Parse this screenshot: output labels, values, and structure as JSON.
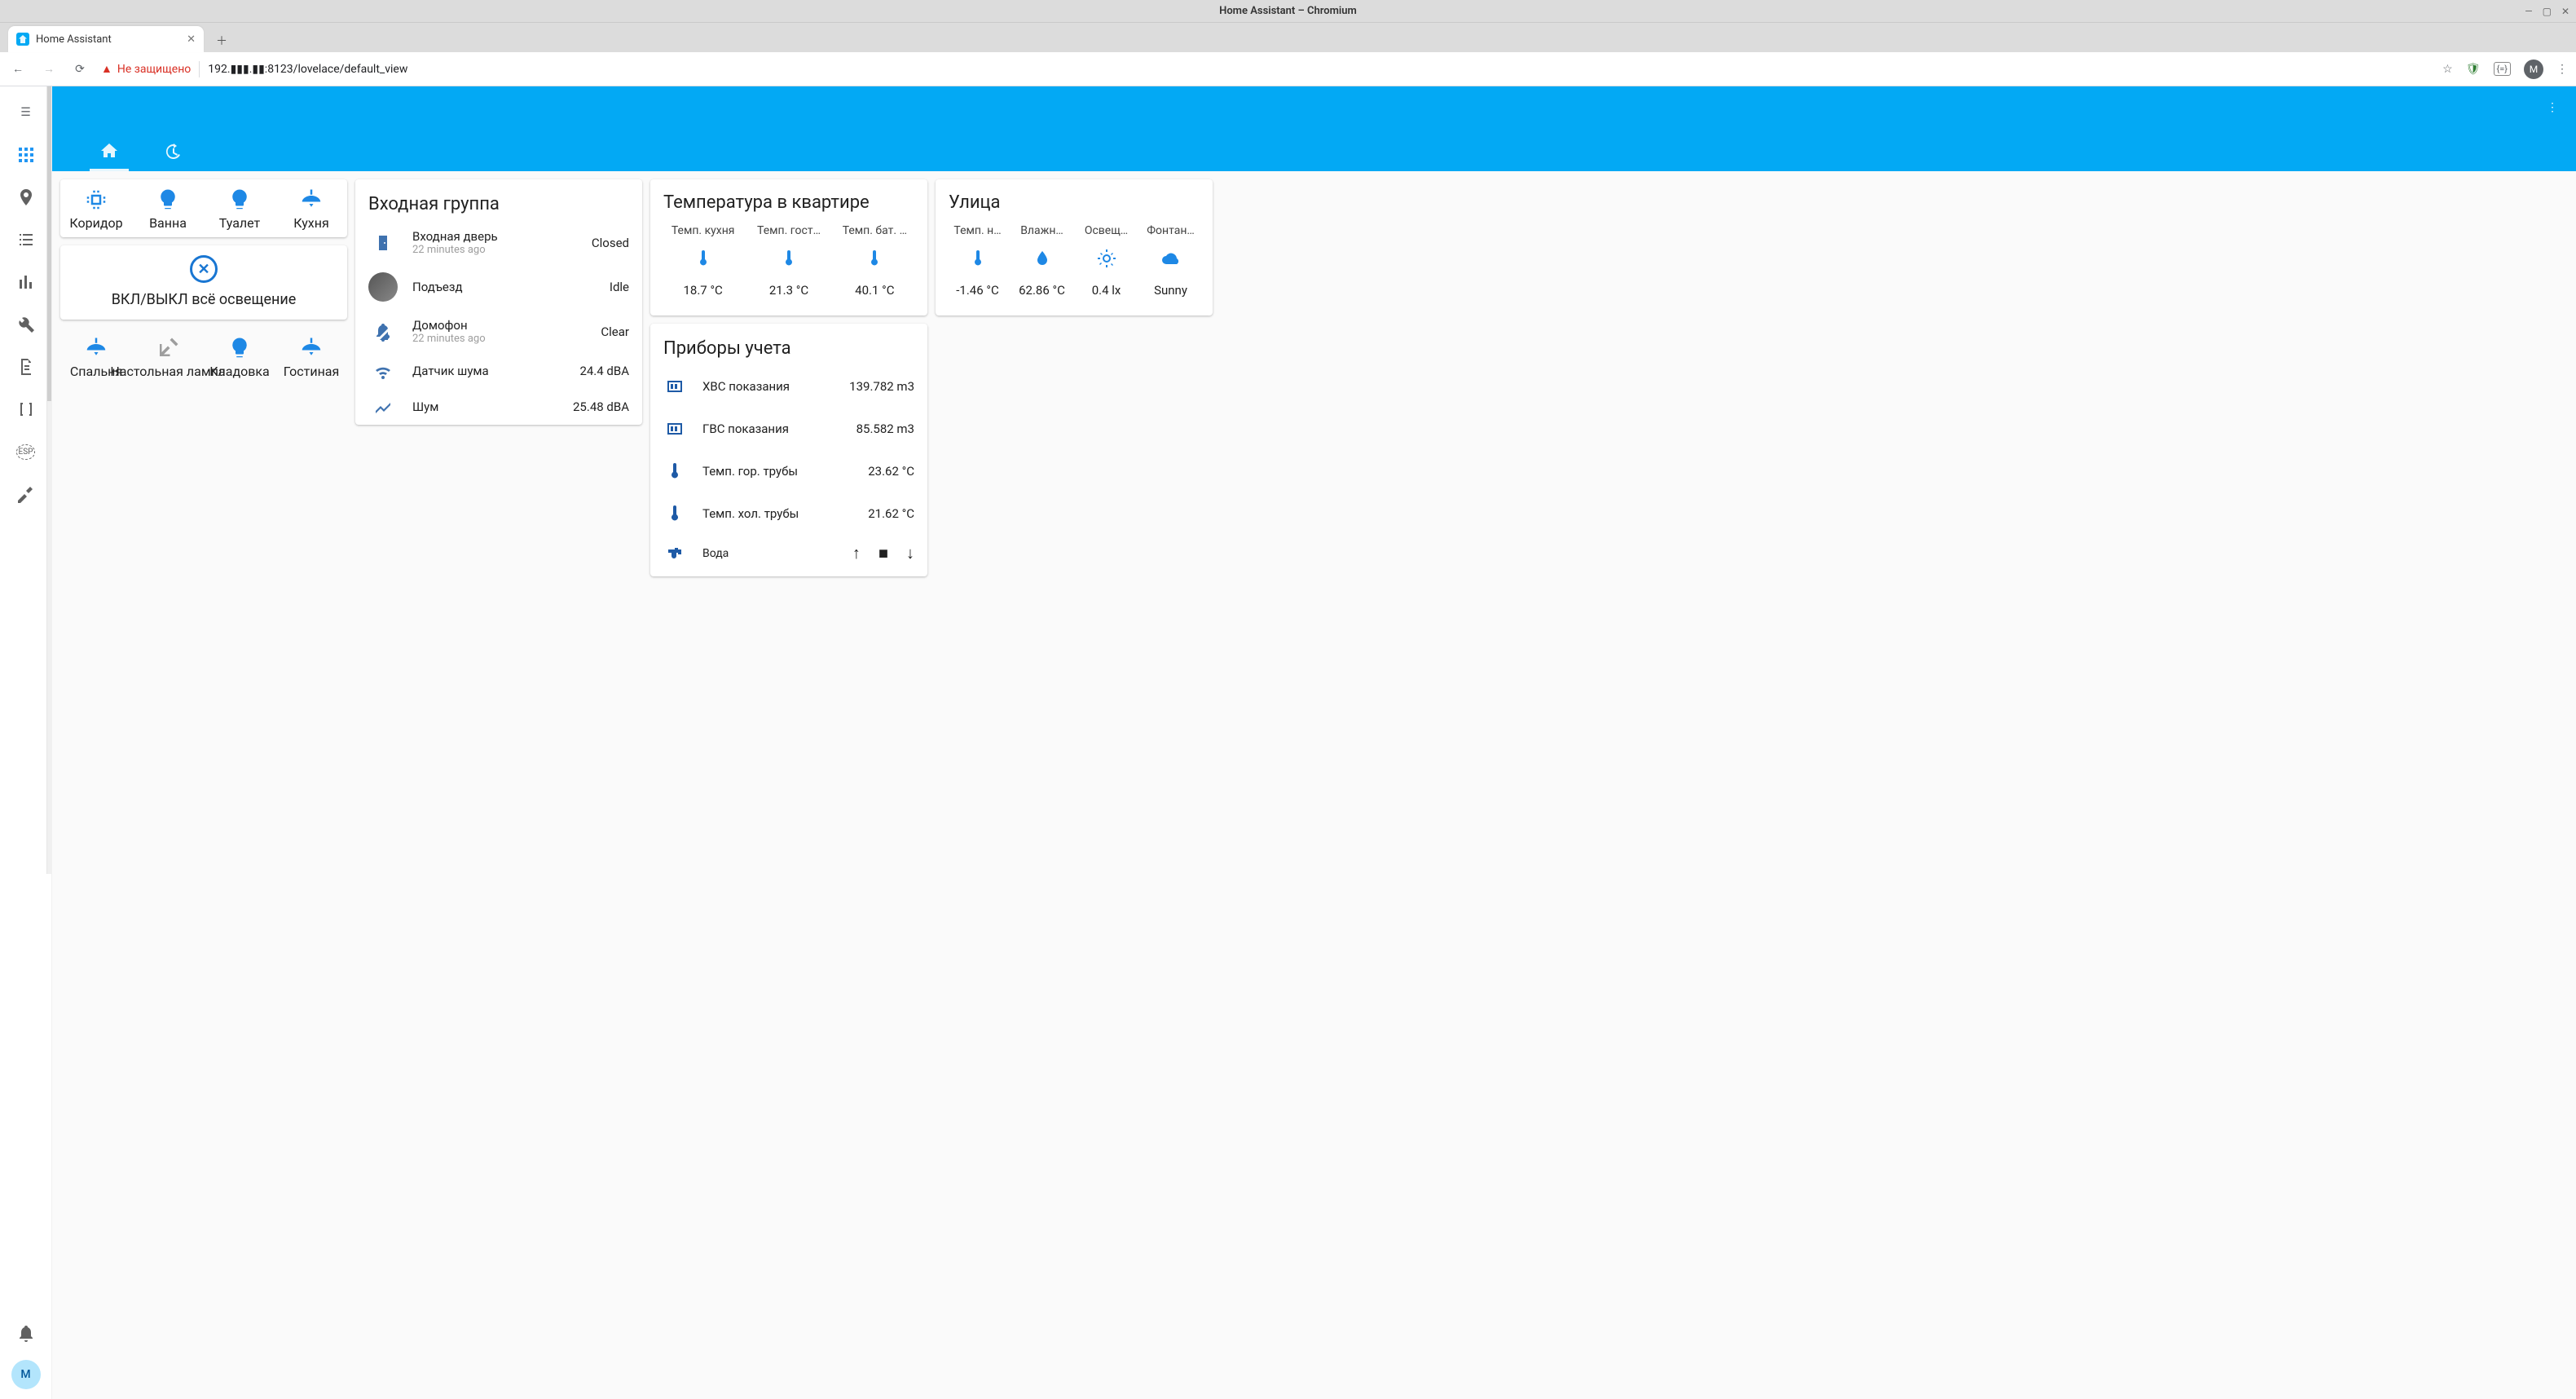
{
  "os": {
    "title": "Home Assistant – Chromium"
  },
  "browser": {
    "tab_title": "Home Assistant",
    "security_label": "Не защищено",
    "url": "192.▮▮▮.▮▮:8123/lovelace/default_view",
    "avatar_letter": "M"
  },
  "sidebar": {
    "avatar_letter": "M"
  },
  "lights": {
    "row1": [
      {
        "label": "Коридор",
        "icon": "memory",
        "state": "on"
      },
      {
        "label": "Ванна",
        "icon": "bulb",
        "state": "on"
      },
      {
        "label": "Туалет",
        "icon": "bulb",
        "state": "on"
      },
      {
        "label": "Кухня",
        "icon": "ceiling",
        "state": "on"
      }
    ],
    "all_toggle_label": "ВКЛ/ВЫКЛ всё освещение",
    "row2": [
      {
        "label": "Спальня",
        "icon": "ceiling",
        "state": "on"
      },
      {
        "label": "Настольная лампа",
        "icon": "desk",
        "state": "off"
      },
      {
        "label": "Кладовка",
        "icon": "bulb",
        "state": "on"
      },
      {
        "label": "Гостиная",
        "icon": "ceiling",
        "state": "on"
      }
    ]
  },
  "entrance": {
    "title": "Входная группа",
    "items": [
      {
        "icon": "door",
        "name": "Входная дверь",
        "sub": "22 minutes ago",
        "value": "Closed"
      },
      {
        "icon": "camera",
        "name": "Подъезд",
        "sub": "",
        "value": "Idle"
      },
      {
        "icon": "bell-off",
        "name": "Домофон",
        "sub": "22 minutes ago",
        "value": "Clear"
      },
      {
        "icon": "wifi",
        "name": "Датчик шума",
        "sub": "",
        "value": "24.4 dBA"
      },
      {
        "icon": "chart",
        "name": "Шум",
        "sub": "",
        "value": "25.48 dBA"
      }
    ]
  },
  "apt_temp": {
    "title": "Температура в квартире",
    "items": [
      {
        "label": "Темп. кухня",
        "icon": "thermo",
        "value": "18.7 °C"
      },
      {
        "label": "Темп. гост…",
        "icon": "thermo",
        "value": "21.3 °C"
      },
      {
        "label": "Темп. бат. …",
        "icon": "thermo",
        "value": "40.1 °C"
      }
    ]
  },
  "street": {
    "title": "Улица",
    "items": [
      {
        "label": "Темп. н…",
        "icon": "thermo",
        "value": "-1.46 °C"
      },
      {
        "label": "Влажн…",
        "icon": "humidity",
        "value": "62.86 °C"
      },
      {
        "label": "Освещ…",
        "icon": "bright",
        "value": "0.4 lx"
      },
      {
        "label": "Фонтан…",
        "icon": "cloud",
        "value": "Sunny"
      }
    ]
  },
  "meters": {
    "title": "Приборы учета",
    "items": [
      {
        "icon": "counter",
        "name": "ХВС показания",
        "value": "139.782 m3"
      },
      {
        "icon": "counter",
        "name": "ГВС показания",
        "value": "85.582 m3"
      },
      {
        "icon": "thermo",
        "name": "Темп. гор. трубы",
        "value": "23.62 °C"
      },
      {
        "icon": "thermo",
        "name": "Темп. хол. трубы",
        "value": "21.62 °C"
      }
    ],
    "media_name": "Вода"
  }
}
